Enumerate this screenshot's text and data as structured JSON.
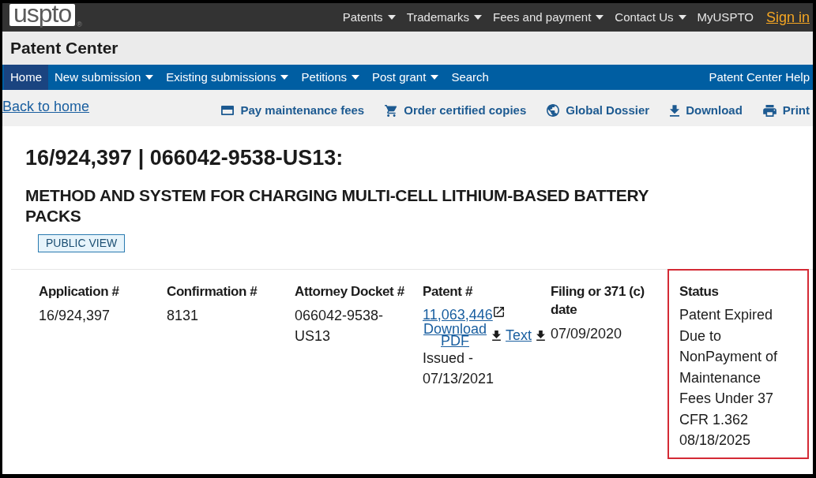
{
  "header": {
    "logo": {
      "text": "uspto",
      "registered_mark": "®"
    },
    "nav": [
      {
        "label": "Patents",
        "dropdown": true
      },
      {
        "label": "Trademarks",
        "dropdown": true
      },
      {
        "label": "Fees and payment",
        "dropdown": true
      },
      {
        "label": "Contact Us",
        "dropdown": true
      },
      {
        "label": "MyUSPTO",
        "dropdown": false
      }
    ],
    "sign_in": "Sign in"
  },
  "app_title": "Patent Center",
  "main_nav": {
    "items": [
      {
        "label": "Home",
        "selected": true,
        "dropdown": false
      },
      {
        "label": "New submission",
        "selected": false,
        "dropdown": true
      },
      {
        "label": "Existing submissions",
        "selected": false,
        "dropdown": true
      },
      {
        "label": "Petitions",
        "selected": false,
        "dropdown": true
      },
      {
        "label": "Post grant",
        "selected": false,
        "dropdown": true
      },
      {
        "label": "Search",
        "selected": false,
        "dropdown": false
      }
    ],
    "help": "Patent Center Help"
  },
  "toolbar": {
    "back_link": "Back to home",
    "actions": [
      {
        "label": "Pay maintenance fees"
      },
      {
        "label": "Order certified copies"
      },
      {
        "label": "Global Dossier"
      },
      {
        "label": "Download"
      },
      {
        "label": "Print"
      }
    ]
  },
  "application": {
    "heading": "16/924,397 | 066042-9538-US13:",
    "title": "METHOD AND SYSTEM FOR CHARGING MULTI-CELL LITHIUM-BASED BATTERY PACKS",
    "badge": "PUBLIC VIEW",
    "details": [
      {
        "kind": "text",
        "label": "Application #",
        "value": "16/924,397",
        "highlighted": false
      },
      {
        "kind": "text",
        "label": "Confirmation #",
        "value": "8131",
        "highlighted": false
      },
      {
        "kind": "text",
        "label": "Attorney Docket #",
        "value": "066042-9538-US13",
        "highlighted": false
      },
      {
        "kind": "patent",
        "label": "Patent #",
        "patent_number": "11,063,446",
        "downloads": [
          {
            "label": "Download PDF"
          },
          {
            "label": "Text"
          }
        ],
        "issued": "Issued - 07/13/2021",
        "highlighted": false
      },
      {
        "kind": "text",
        "label": "Filing or 371 (c) date",
        "value": "07/09/2020",
        "highlighted": false
      },
      {
        "kind": "status",
        "label": "Status",
        "value": "Patent Expired Due to NonPayment of Maintenance Fees Under 37 CFR 1.362",
        "date": "08/18/2025",
        "highlighted": true
      }
    ]
  }
}
